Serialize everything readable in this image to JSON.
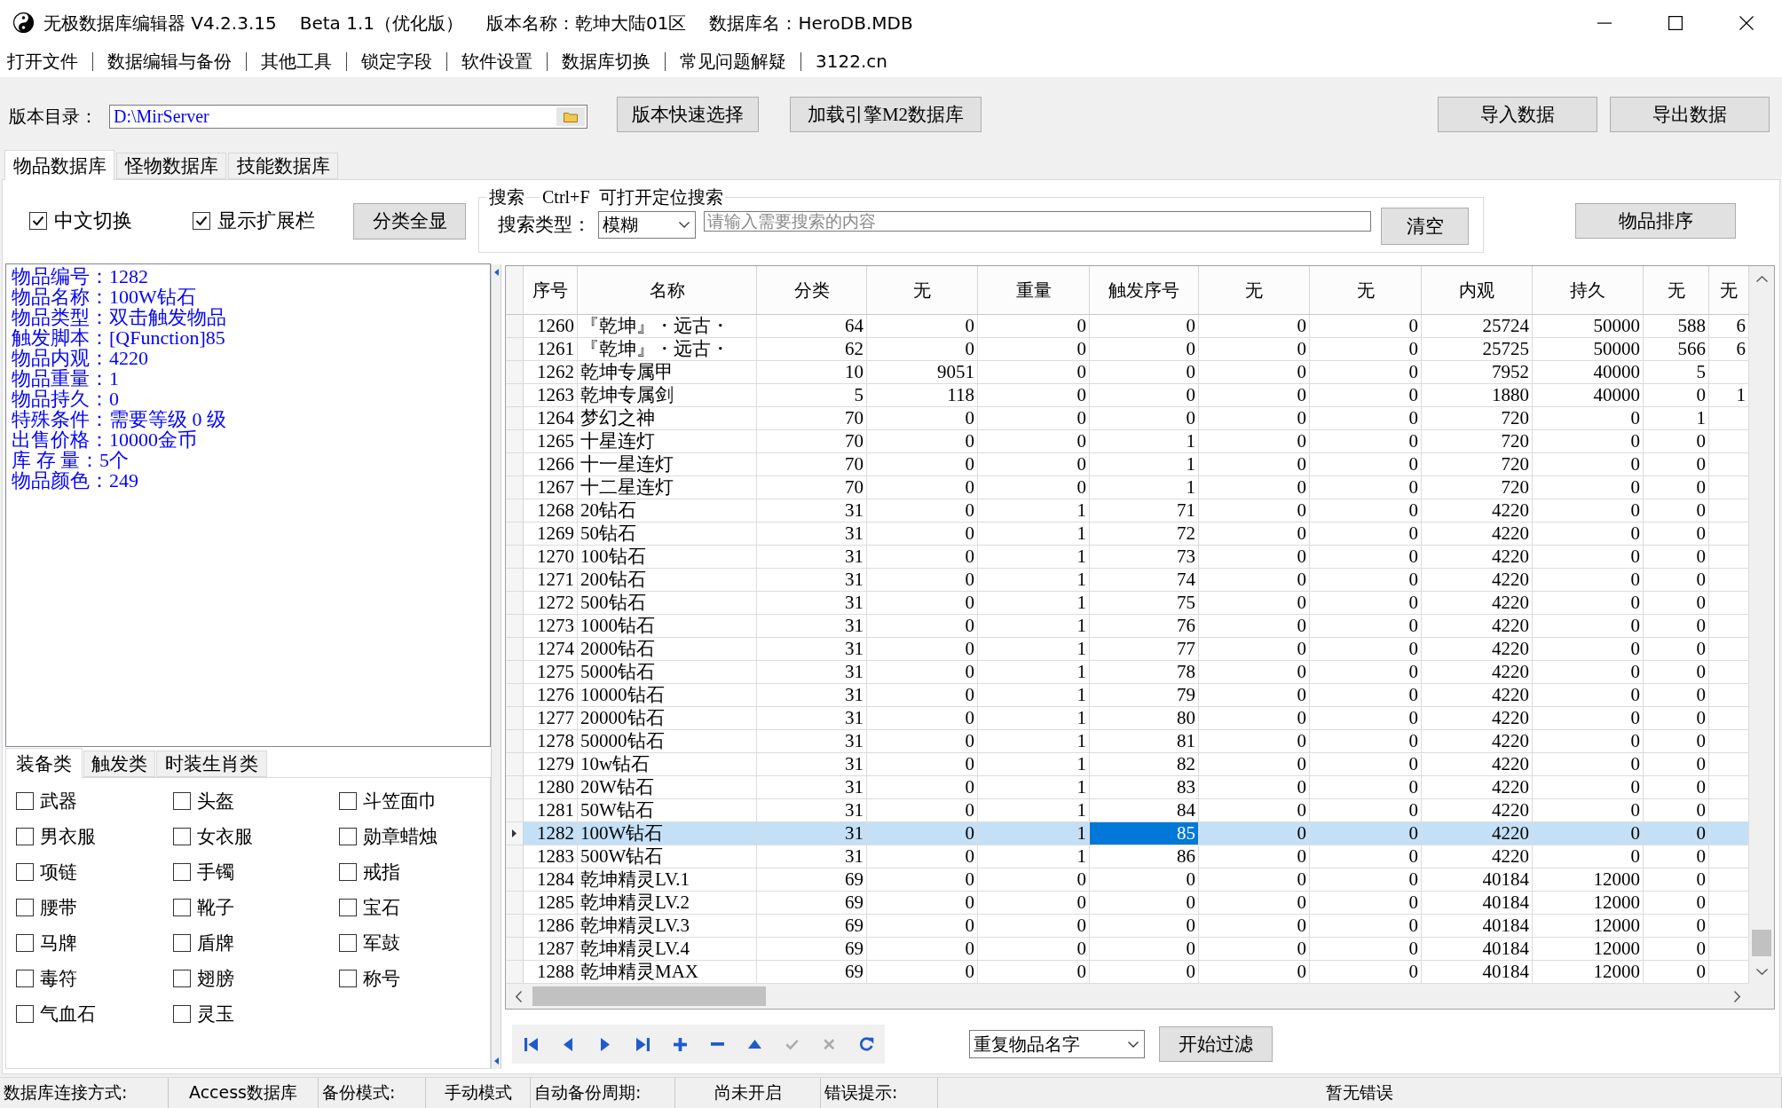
{
  "window": {
    "title_parts": [
      "无极数据库编辑器 V4.2.3.15",
      "Beta 1.1（优化版）",
      "版本名称：乾坤大陆01区",
      "数据库名：HeroDB.MDB"
    ]
  },
  "menu": [
    "打开文件",
    "数据编辑与备份",
    "其他工具",
    "锁定字段",
    "软件设置",
    "数据库切换",
    "常见问题解疑",
    "3122.cn"
  ],
  "toolbar": {
    "path_label": "版本目录：",
    "path_value": "D:\\MirServer",
    "buttons": [
      "版本快速选择",
      "加载引擎M2数据库"
    ],
    "right_buttons": [
      "导入数据",
      "导出数据"
    ]
  },
  "tabs": [
    {
      "label": "物品数据库",
      "selected": true
    },
    {
      "label": "怪物数据库",
      "selected": false
    },
    {
      "label": "技能数据库",
      "selected": false
    }
  ],
  "options": [
    {
      "label": "中文切换",
      "checked": true
    },
    {
      "label": "显示扩展栏",
      "checked": true
    }
  ],
  "show_all_button": "分类全显",
  "search": {
    "title": "搜索",
    "hint": "Ctrl+F  可打开定位搜索",
    "type_label": "搜索类型：",
    "type_value": "模糊",
    "placeholder": "请输入需要搜索的内容",
    "clear_button": "清空"
  },
  "sort_button": "物品排序",
  "item_info": [
    "物品编号：1282",
    "物品名称：100W钻石",
    "物品类型：双击触发物品",
    "触发脚本：[QFunction]85",
    "物品内观：4220",
    "物品重量：1",
    "物品持久：0",
    "特殊条件：需要等级 0 级",
    "出售价格：10000金币",
    "库 存 量：5个",
    "物品颜色：249"
  ],
  "category_tabs": [
    {
      "label": "装备类",
      "selected": true
    },
    {
      "label": "触发类",
      "selected": false
    },
    {
      "label": "时装生肖类",
      "selected": false
    }
  ],
  "categories": [
    {
      "label": "武器",
      "checked": false
    },
    {
      "label": "头盔",
      "checked": false
    },
    {
      "label": "斗笠面巾",
      "checked": false
    },
    {
      "label": "男衣服",
      "checked": false
    },
    {
      "label": "女衣服",
      "checked": false
    },
    {
      "label": "勋章蜡烛",
      "checked": false
    },
    {
      "label": "项链",
      "checked": false
    },
    {
      "label": "手镯",
      "checked": false
    },
    {
      "label": "戒指",
      "checked": false
    },
    {
      "label": "腰带",
      "checked": false
    },
    {
      "label": "靴子",
      "checked": false
    },
    {
      "label": "宝石",
      "checked": false
    },
    {
      "label": "马牌",
      "checked": false
    },
    {
      "label": "盾牌",
      "checked": false
    },
    {
      "label": "军鼓",
      "checked": false
    },
    {
      "label": "毒符",
      "checked": false
    },
    {
      "label": "翅膀",
      "checked": false
    },
    {
      "label": "称号",
      "checked": false
    },
    {
      "label": "气血石",
      "checked": false
    },
    {
      "label": "灵玉",
      "checked": false
    }
  ],
  "table": {
    "columns": [
      {
        "label": "序号",
        "focused": false
      },
      {
        "label": "名称",
        "focused": false
      },
      {
        "label": "分类",
        "focused": false
      },
      {
        "label": "无",
        "focused": false
      },
      {
        "label": "重量",
        "focused": false
      },
      {
        "label": "触发序号",
        "focused": true
      },
      {
        "label": "无",
        "focused": false
      },
      {
        "label": "无",
        "focused": false
      },
      {
        "label": "内观",
        "focused": false
      },
      {
        "label": "持久",
        "focused": false
      },
      {
        "label": "无",
        "focused": false
      },
      {
        "label": "无",
        "focused": false
      }
    ],
    "rows": [
      {
        "cells": [
          "1260",
          "『乾坤』・远古・",
          "64",
          "0",
          "0",
          "0",
          "0",
          "0",
          "25724",
          "50000",
          "588",
          "6"
        ],
        "selected": false
      },
      {
        "cells": [
          "1261",
          "『乾坤』・远古・",
          "62",
          "0",
          "0",
          "0",
          "0",
          "0",
          "25725",
          "50000",
          "566",
          "6"
        ],
        "selected": false
      },
      {
        "cells": [
          "1262",
          "乾坤专属甲",
          "10",
          "9051",
          "0",
          "0",
          "0",
          "0",
          "7952",
          "40000",
          "5"
        ],
        "selected": false
      },
      {
        "cells": [
          "1263",
          "乾坤专属剑",
          "5",
          "118",
          "0",
          "0",
          "0",
          "0",
          "1880",
          "40000",
          "0",
          "1"
        ],
        "selected": false
      },
      {
        "cells": [
          "1264",
          "梦幻之神",
          "70",
          "0",
          "0",
          "0",
          "0",
          "0",
          "720",
          "0",
          "1"
        ],
        "selected": false
      },
      {
        "cells": [
          "1265",
          "十星连灯",
          "70",
          "0",
          "0",
          "1",
          "0",
          "0",
          "720",
          "0",
          "0"
        ],
        "selected": false
      },
      {
        "cells": [
          "1266",
          "十一星连灯",
          "70",
          "0",
          "0",
          "1",
          "0",
          "0",
          "720",
          "0",
          "0"
        ],
        "selected": false
      },
      {
        "cells": [
          "1267",
          "十二星连灯",
          "70",
          "0",
          "0",
          "1",
          "0",
          "0",
          "720",
          "0",
          "0"
        ],
        "selected": false
      },
      {
        "cells": [
          "1268",
          "20钻石",
          "31",
          "0",
          "1",
          "71",
          "0",
          "0",
          "4220",
          "0",
          "0"
        ],
        "selected": false
      },
      {
        "cells": [
          "1269",
          "50钻石",
          "31",
          "0",
          "1",
          "72",
          "0",
          "0",
          "4220",
          "0",
          "0"
        ],
        "selected": false
      },
      {
        "cells": [
          "1270",
          "100钻石",
          "31",
          "0",
          "1",
          "73",
          "0",
          "0",
          "4220",
          "0",
          "0"
        ],
        "selected": false
      },
      {
        "cells": [
          "1271",
          "200钻石",
          "31",
          "0",
          "1",
          "74",
          "0",
          "0",
          "4220",
          "0",
          "0"
        ],
        "selected": false
      },
      {
        "cells": [
          "1272",
          "500钻石",
          "31",
          "0",
          "1",
          "75",
          "0",
          "0",
          "4220",
          "0",
          "0"
        ],
        "selected": false
      },
      {
        "cells": [
          "1273",
          "1000钻石",
          "31",
          "0",
          "1",
          "76",
          "0",
          "0",
          "4220",
          "0",
          "0"
        ],
        "selected": false
      },
      {
        "cells": [
          "1274",
          "2000钻石",
          "31",
          "0",
          "1",
          "77",
          "0",
          "0",
          "4220",
          "0",
          "0"
        ],
        "selected": false
      },
      {
        "cells": [
          "1275",
          "5000钻石",
          "31",
          "0",
          "1",
          "78",
          "0",
          "0",
          "4220",
          "0",
          "0"
        ],
        "selected": false
      },
      {
        "cells": [
          "1276",
          "10000钻石",
          "31",
          "0",
          "1",
          "79",
          "0",
          "0",
          "4220",
          "0",
          "0"
        ],
        "selected": false
      },
      {
        "cells": [
          "1277",
          "20000钻石",
          "31",
          "0",
          "1",
          "80",
          "0",
          "0",
          "4220",
          "0",
          "0"
        ],
        "selected": false
      },
      {
        "cells": [
          "1278",
          "50000钻石",
          "31",
          "0",
          "1",
          "81",
          "0",
          "0",
          "4220",
          "0",
          "0"
        ],
        "selected": false
      },
      {
        "cells": [
          "1279",
          "10w钻石",
          "31",
          "0",
          "1",
          "82",
          "0",
          "0",
          "4220",
          "0",
          "0"
        ],
        "selected": false
      },
      {
        "cells": [
          "1280",
          "20W钻石",
          "31",
          "0",
          "1",
          "83",
          "0",
          "0",
          "4220",
          "0",
          "0"
        ],
        "selected": false
      },
      {
        "cells": [
          "1281",
          "50W钻石",
          "31",
          "0",
          "1",
          "84",
          "0",
          "0",
          "4220",
          "0",
          "0"
        ],
        "selected": false
      },
      {
        "cells": [
          "1282",
          "100W钻石",
          "31",
          "0",
          "1",
          "85",
          "0",
          "0",
          "4220",
          "0",
          "0"
        ],
        "selected": true
      },
      {
        "cells": [
          "1283",
          "500W钻石",
          "31",
          "0",
          "1",
          "86",
          "0",
          "0",
          "4220",
          "0",
          "0"
        ],
        "selected": false
      },
      {
        "cells": [
          "1284",
          "乾坤精灵LV.1",
          "69",
          "0",
          "0",
          "0",
          "0",
          "0",
          "40184",
          "12000",
          "0"
        ],
        "selected": false
      },
      {
        "cells": [
          "1285",
          "乾坤精灵LV.2",
          "69",
          "0",
          "0",
          "0",
          "0",
          "0",
          "40184",
          "12000",
          "0"
        ],
        "selected": false
      },
      {
        "cells": [
          "1286",
          "乾坤精灵LV.3",
          "69",
          "0",
          "0",
          "0",
          "0",
          "0",
          "40184",
          "12000",
          "0"
        ],
        "selected": false
      },
      {
        "cells": [
          "1287",
          "乾坤精灵LV.4",
          "69",
          "0",
          "0",
          "0",
          "0",
          "0",
          "40184",
          "12000",
          "0"
        ],
        "selected": false
      },
      {
        "cells": [
          "1288",
          "乾坤精灵MAX",
          "69",
          "0",
          "0",
          "0",
          "0",
          "0",
          "40184",
          "12000",
          "0"
        ],
        "selected": false
      }
    ]
  },
  "navigator": [
    {
      "kind": "first",
      "disabled": false
    },
    {
      "kind": "prior",
      "disabled": false
    },
    {
      "kind": "next",
      "disabled": false
    },
    {
      "kind": "last",
      "disabled": false
    },
    {
      "kind": "insert",
      "disabled": false
    },
    {
      "kind": "delete",
      "disabled": false
    },
    {
      "kind": "edit",
      "disabled": false
    },
    {
      "kind": "post",
      "disabled": true
    },
    {
      "kind": "cancel",
      "disabled": true
    },
    {
      "kind": "refresh",
      "disabled": false
    }
  ],
  "filter": {
    "value": "重复物品名字",
    "button": "开始过滤"
  },
  "status_bar": [
    {
      "label": "数据库连接方式:",
      "value": "Access数据库"
    },
    {
      "label": "备份模式:",
      "value": "手动模式"
    },
    {
      "label": "自动备份周期:",
      "value": "尚未开启"
    },
    {
      "label": "错误提示:",
      "value": "暂无错误"
    }
  ]
}
